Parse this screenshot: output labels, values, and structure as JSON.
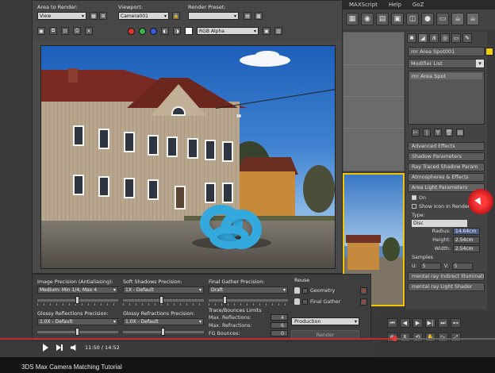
{
  "menubar": [
    "MAXScript",
    "Help",
    "GoZ"
  ],
  "render_frame": {
    "area_label": "Area to Render:",
    "area_value": "View",
    "viewport_label": "Viewport:",
    "viewport_value": "Camera001",
    "preset_label": "Render Preset:",
    "preset_value": "",
    "channel_value": "RGB Alpha"
  },
  "settings": {
    "image_precision_label": "Image Precision (Antialiasing):",
    "image_precision_value": "Medium: Min 1/4, Max 4",
    "soft_shadows_label": "Soft Shadows Precision:",
    "soft_shadows_value": "1X - Default",
    "final_gather_label": "Final Gather Precision:",
    "final_gather_value": "Draft",
    "glossy_reflections_label": "Glossy Reflections Precision:",
    "glossy_reflections_value": "1.0X - Default",
    "glossy_refractions_label": "Glossy Refractions Precision:",
    "glossy_refractions_value": "1.0X - Default",
    "reuse_label": "Reuse",
    "reuse_geometry": "Geometry",
    "reuse_final_gather": "Final Gather",
    "trace_label": "Trace/Bounces Limits",
    "max_reflections_label": "Max. Reflections:",
    "max_reflections_value": "4",
    "max_refractions_label": "Max. Refractions:",
    "max_refractions_value": "6",
    "fg_bounces_label": "FG Bounces:",
    "fg_bounces_value": "0",
    "production_value": "Production",
    "render_button": "Render"
  },
  "command_panel": {
    "object_name": "mr Area Spot001",
    "modifier_list": "Modifier List",
    "stack_item": "mr Area Spot",
    "rollouts": {
      "advanced_effects": "Advanced Effects",
      "shadow_parameters": "Shadow Parameters",
      "ray_traced": "Ray Traced Shadow Param",
      "atmospheres": "Atmospheres & Effects",
      "area_light": "Area Light Parameters",
      "indirect": "mental ray Indirect Illumination",
      "light_shader": "mental ray Light Shader"
    },
    "on_label": "On",
    "show_icon_label": "Show Icon in Renderer",
    "type_label": "Type:",
    "type_value": "Disc",
    "radius_label": "Radius:",
    "radius_value": "14.64cm",
    "height_label": "Height:",
    "height_value": "2.54cm",
    "width_label": "Width:",
    "width_value": "2.54cm",
    "samples_label": "Samples",
    "u_label": "U:",
    "u_value": "5",
    "v_label": "V:",
    "v_value": "5"
  },
  "video": {
    "time": "11:50 / 14:52",
    "title": "3DS Max Camera Matching Tutorial",
    "progress_fraction": 0.7962
  }
}
